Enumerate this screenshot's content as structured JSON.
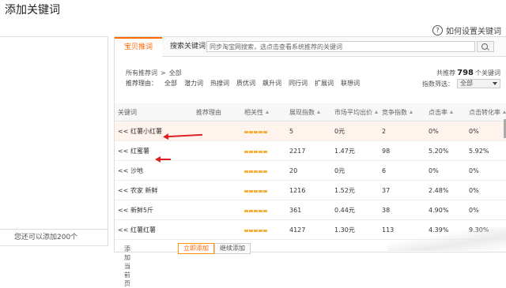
{
  "dialog": {
    "title": "添加关键词",
    "help_text": "如何设置关键词"
  },
  "left_panel": {
    "footer_text": "您还可以添加200个"
  },
  "tabs": [
    {
      "label": "宝贝推词"
    },
    {
      "label": "搜索关键词"
    }
  ],
  "search": {
    "placeholder": "同步淘宝网搜索，选点击查看系统推荐的关键词"
  },
  "breadcrumb": {
    "root": "所有推荐词",
    "separator": ">",
    "current": "全部"
  },
  "total": {
    "prefix": "共推荐",
    "count": "798",
    "suffix": "个关键词"
  },
  "filters": {
    "label": "推荐理由：",
    "items": [
      "全部",
      "潜力词",
      "热搜词",
      "质优词",
      "飙升词",
      "同行词",
      "扩展词",
      "联想词"
    ]
  },
  "index_filter": {
    "label": "指数筛选：",
    "value": "全部"
  },
  "table": {
    "headers": [
      "关键词",
      "推荐理由",
      "相关性",
      "展现指数",
      "市场平均出价",
      "竞争指数",
      "点击率",
      "点击转化率"
    ],
    "rows": [
      {
        "keyword": "<< 红薯小红薯",
        "reason": "",
        "impressions": "5",
        "avg_bid": "0元",
        "competition": "2",
        "ctr": "0%",
        "cvr": "0%"
      },
      {
        "keyword": "<< 红蜜薯",
        "reason": "",
        "impressions": "2217",
        "avg_bid": "1.47元",
        "competition": "98",
        "ctr": "5.20%",
        "cvr": "5.92%"
      },
      {
        "keyword": "<< 沙地",
        "reason": "",
        "impressions": "20",
        "avg_bid": "0元",
        "competition": "6",
        "ctr": "0%",
        "cvr": "0%"
      },
      {
        "keyword": "<< 农家 新鲜",
        "reason": "",
        "impressions": "1216",
        "avg_bid": "1.52元",
        "competition": "37",
        "ctr": "2.48%",
        "cvr": "0%"
      },
      {
        "keyword": "<< 新鲜5斤",
        "reason": "",
        "impressions": "361",
        "avg_bid": "0.44元",
        "competition": "38",
        "ctr": "4.90%",
        "cvr": "0%"
      },
      {
        "keyword": "<< 红薯红薯",
        "reason": "",
        "impressions": "4127",
        "avg_bid": "1.30元",
        "competition": "113",
        "ctr": "4.39%",
        "cvr": "9.30%"
      }
    ]
  },
  "footer": {
    "add_label": "添加当前页",
    "btn1": "立即添加",
    "btn2": "继续添加"
  },
  "colors": {
    "accent": "#ff6600",
    "relevance_bar": "#f7b03c",
    "annotation_arrow": "#e02020"
  }
}
